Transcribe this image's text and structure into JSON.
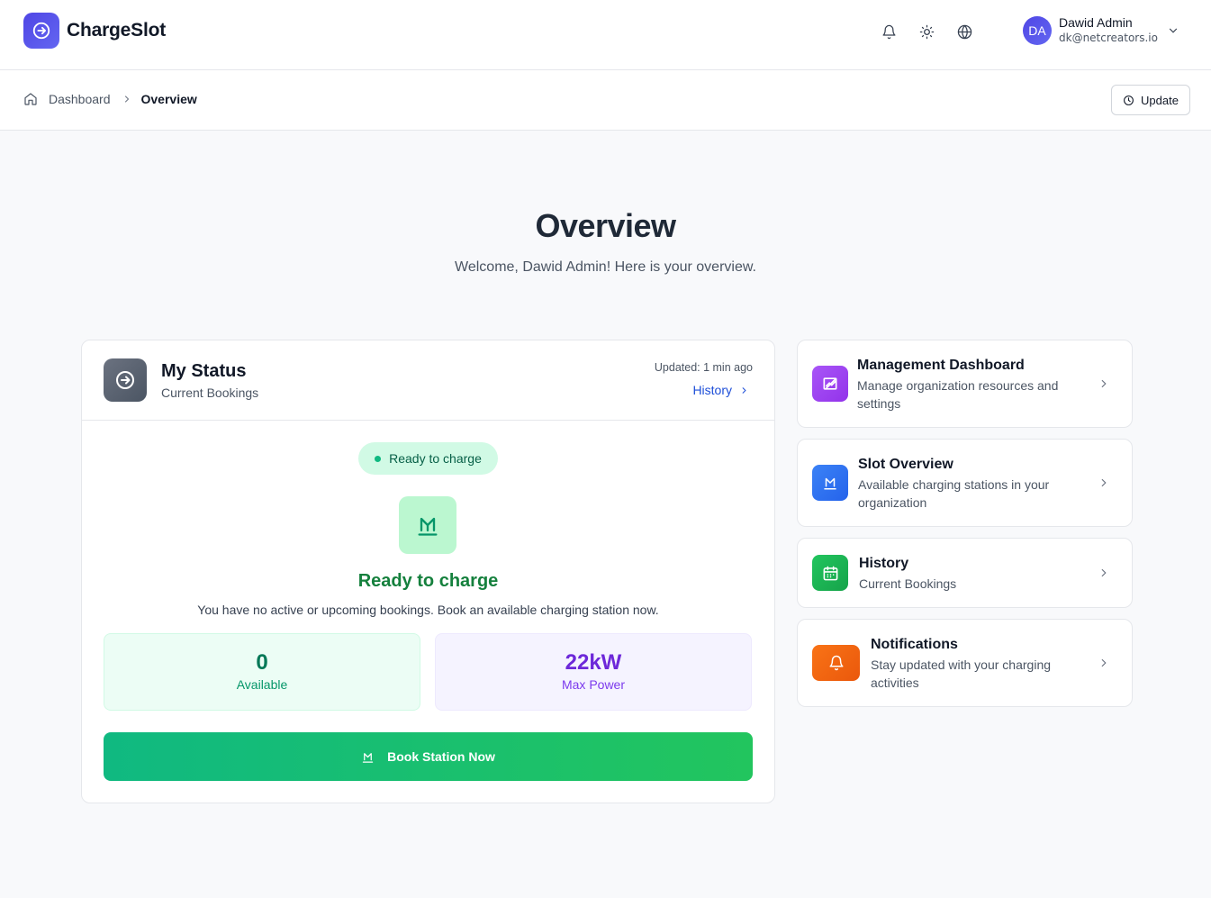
{
  "app": {
    "name": "ChargeSlot"
  },
  "header": {
    "icons": [
      "bell-icon",
      "sun-icon",
      "globe-icon"
    ],
    "user": {
      "initials": "DA",
      "name": "Dawid Admin",
      "email": "dk@netcreators.io"
    }
  },
  "breadcrumb": {
    "items": [
      "Dashboard",
      "Overview"
    ],
    "update_label": "Update"
  },
  "hero": {
    "title": "Overview",
    "subtitle": "Welcome, Dawid Admin! Here is your overview."
  },
  "status": {
    "title": "My Status",
    "subtitle": "Current Bookings",
    "updated": "Updated: 1 min ago",
    "history_link": "History",
    "pill": "Ready to charge",
    "ready_title": "Ready to charge",
    "description": "You have no active or upcoming bookings. Book an available charging station now.",
    "stats": [
      {
        "value": "0",
        "label": "Available"
      },
      {
        "value": "22kW",
        "label": "Max Power"
      }
    ],
    "book_button": "Book Station Now"
  },
  "side_cards": [
    {
      "title": "Management Dashboard",
      "description": "Manage organization resources and settings",
      "icon": "chart-edit-icon",
      "color": "#9333ea"
    },
    {
      "title": "Slot Overview",
      "description": "Available charging stations in your organization",
      "icon": "charging-icon",
      "color": "#2563eb"
    },
    {
      "title": "History",
      "description": "Current Bookings",
      "icon": "calendar-icon",
      "color": "#16a34a"
    },
    {
      "title": "Notifications",
      "description": "Stay updated with your charging activities",
      "icon": "bell-icon",
      "color": "#ea580c"
    }
  ],
  "colors": {
    "brand": "#4f46e5",
    "success": "#15803d",
    "link": "#1d4ed8",
    "power": "#6d28d9"
  }
}
